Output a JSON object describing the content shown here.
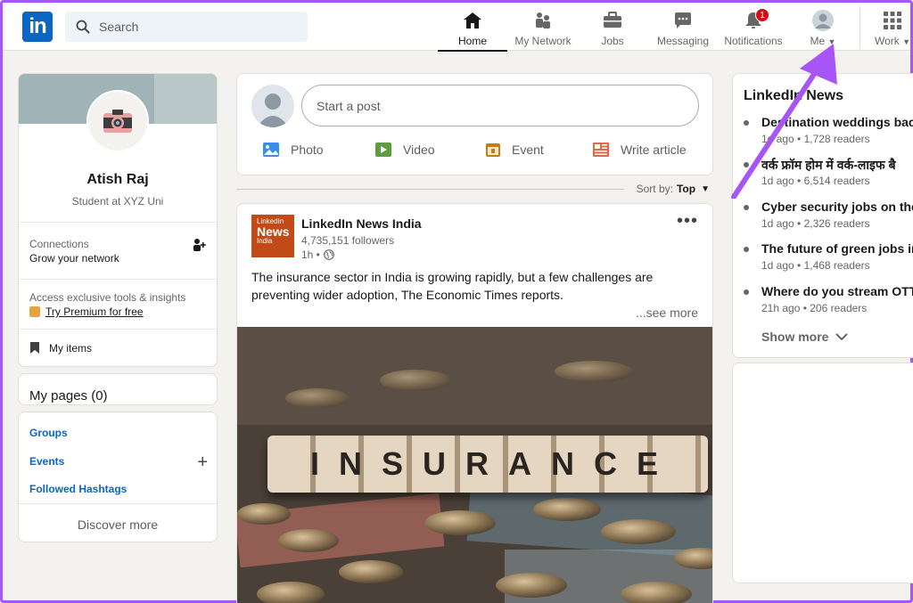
{
  "nav": {
    "logo": "in",
    "search_placeholder": "Search",
    "items": [
      {
        "label": "Home",
        "icon": "home-icon"
      },
      {
        "label": "My Network",
        "icon": "network-icon"
      },
      {
        "label": "Jobs",
        "icon": "briefcase-icon"
      },
      {
        "label": "Messaging",
        "icon": "messaging-icon"
      },
      {
        "label": "Notifications",
        "icon": "bell-icon",
        "badge": "1"
      },
      {
        "label": "Me",
        "icon": "avatar-icon"
      },
      {
        "label": "Work",
        "icon": "grid-icon"
      }
    ]
  },
  "profile": {
    "name": "Atish Raj",
    "headline": "Student at XYZ Uni",
    "connections_title": "Connections",
    "connections_sub": "Grow your network",
    "premium_text": "Access exclusive tools & insights",
    "premium_link": "Try Premium for free",
    "my_items": "My items"
  },
  "pages": {
    "label": "My pages (0)"
  },
  "links": {
    "groups": "Groups",
    "events": "Events",
    "hashtags": "Followed Hashtags",
    "discover": "Discover more"
  },
  "share": {
    "start_post": "Start a post",
    "actions": [
      "Photo",
      "Video",
      "Event",
      "Write article"
    ]
  },
  "sort": {
    "label": "Sort by:",
    "value": "Top"
  },
  "post": {
    "logo_line1": "LinkedIn",
    "logo_line2": "News",
    "logo_line3": "India",
    "company": "LinkedIn News India",
    "followers": "4,735,151 followers",
    "time": "1h •",
    "text": "The insurance sector in India is growing rapidly, but a few challenges are preventing wider adoption, The Economic Times reports.",
    "see_more": "...see more",
    "image_word": "INSURANCE"
  },
  "news": {
    "title": "LinkedIn News",
    "items": [
      {
        "headline": "Destination weddings back",
        "meta": "1d ago • 1,728 readers"
      },
      {
        "headline": "वर्क फ्रॉम होम में वर्क-लाइफ बै",
        "meta": "1d ago • 6,514 readers"
      },
      {
        "headline": "Cyber security jobs on the r",
        "meta": "1d ago • 2,326 readers"
      },
      {
        "headline": "The future of green jobs in",
        "meta": "1d ago • 1,468 readers"
      },
      {
        "headline": "Where do you stream OTT c",
        "meta": "21h ago • 206 readers"
      }
    ],
    "show_more": "Show more"
  },
  "colors": {
    "brand": "#0a66c2",
    "badge": "#cc1016",
    "accent_arrow": "#a855f7"
  }
}
